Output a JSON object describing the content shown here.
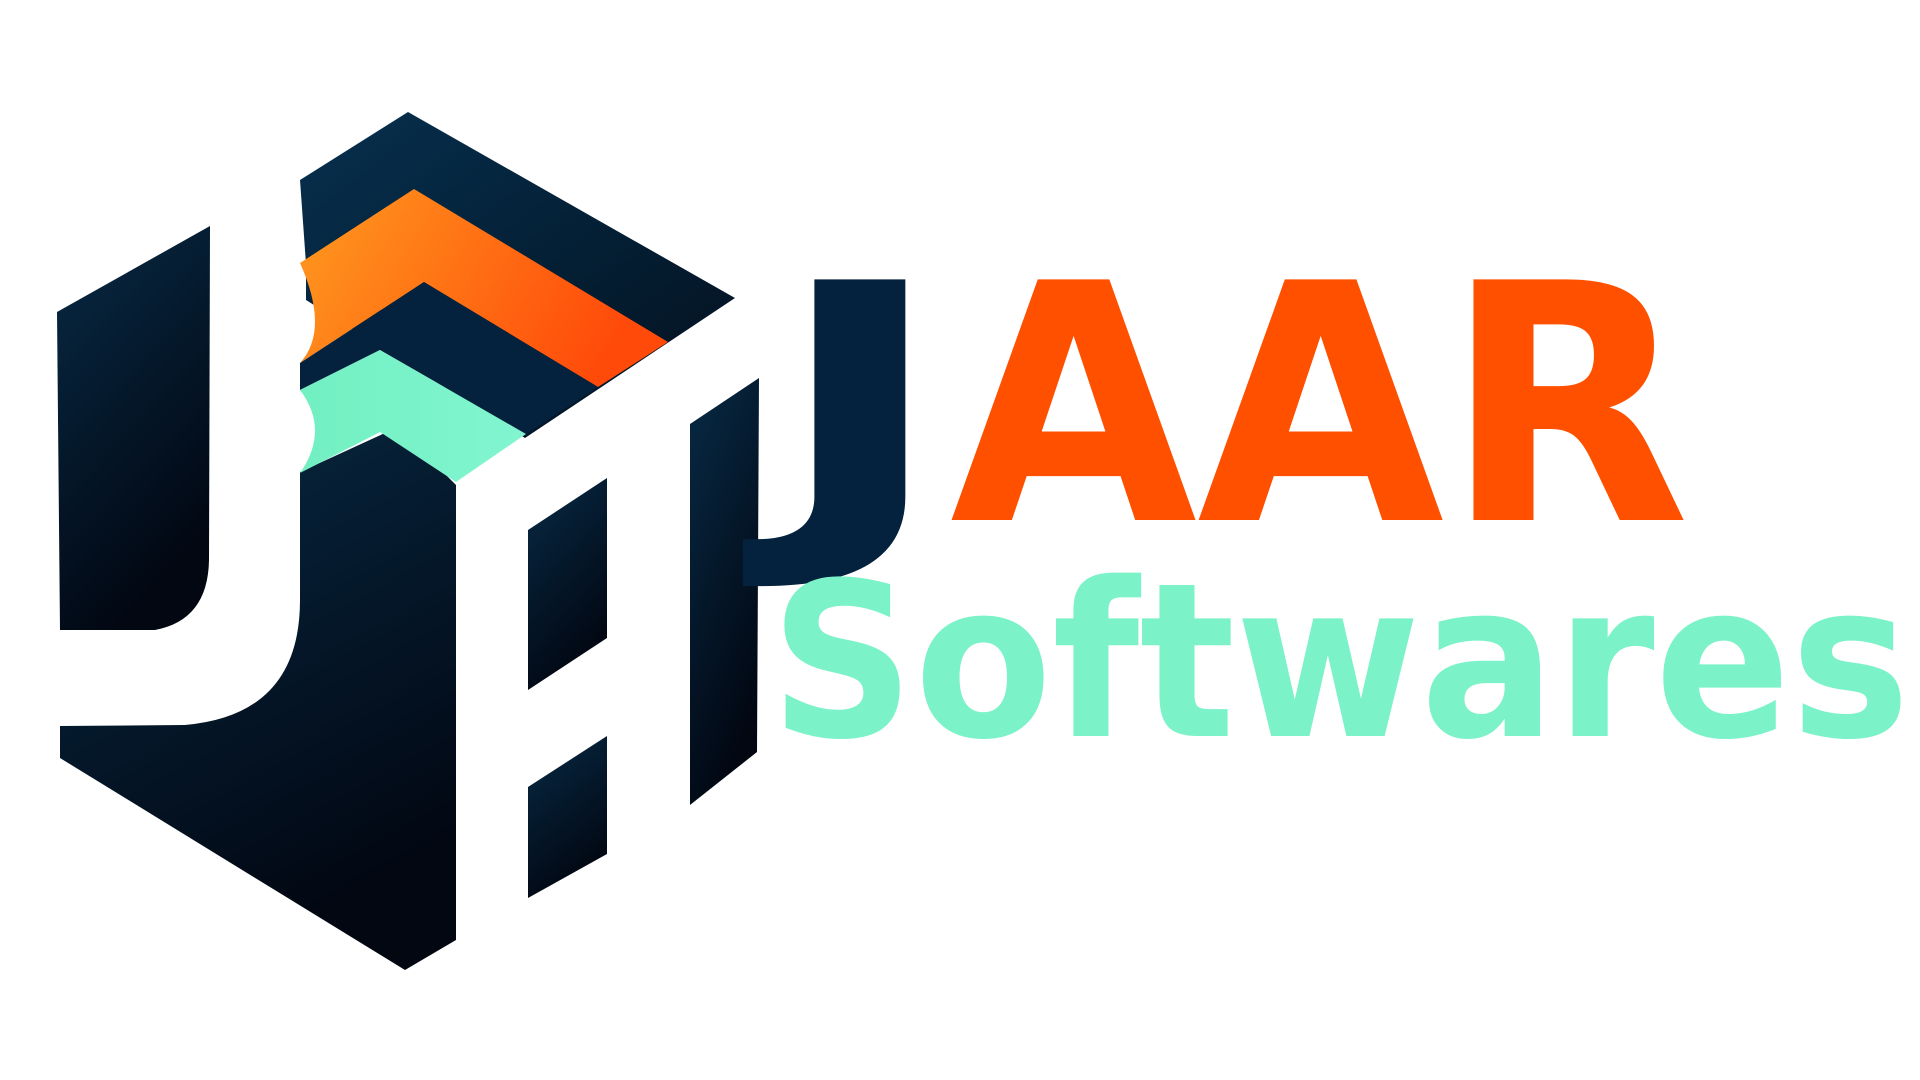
{
  "brand": {
    "name_primary_j": "J",
    "name_primary_rest": "AAR",
    "name_secondary": "Softwares"
  },
  "icon": {
    "name": "jaar-hexagon-logo-icon"
  },
  "colors": {
    "navy": "#04223d",
    "navy_dark": "#02080f",
    "orange": "#ff5000",
    "orange_light": "#ff9a1f",
    "mint": "#7cf2c9",
    "background": "#ffffff"
  }
}
